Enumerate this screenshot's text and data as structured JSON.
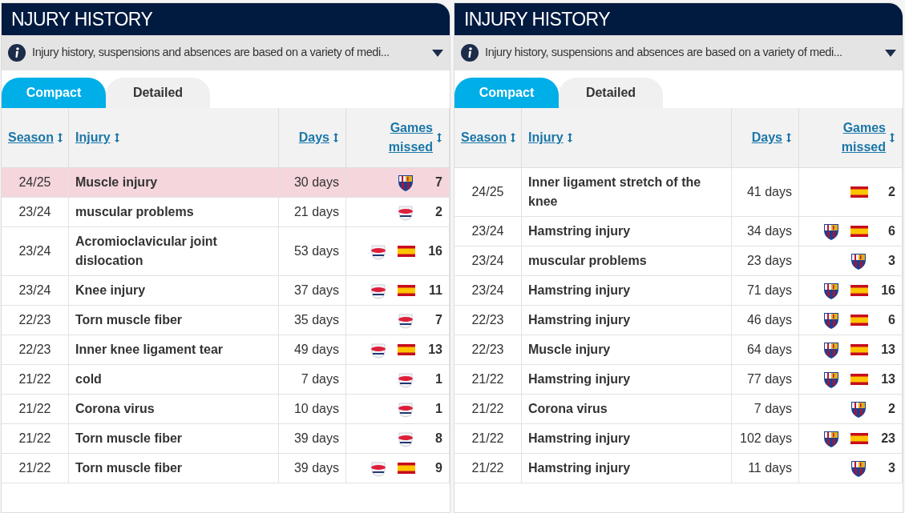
{
  "panels": [
    {
      "title": "NJURY HISTORY",
      "info": "Injury history, suspensions and absences are based on a variety of medi...",
      "tabs": [
        {
          "label": "Compact",
          "selected": true
        },
        {
          "label": "Detailed",
          "selected": false
        }
      ],
      "columns": [
        "Season",
        "Injury",
        "Days",
        "Games missed"
      ],
      "rows": [
        {
          "season": "24/25",
          "injury": "Muscle injury",
          "days": "30 days",
          "games": "7",
          "highlighted": true,
          "marks": [
            {
              "kind": "shield"
            }
          ]
        },
        {
          "season": "23/24",
          "injury": "muscular problems",
          "days": "21 days",
          "games": "2",
          "highlighted": false,
          "marks": [
            {
              "kind": "crest"
            }
          ]
        },
        {
          "season": "23/24",
          "injury": "Acromioclavicular joint dislocation",
          "days": "53 days",
          "games": "16",
          "highlighted": false,
          "marks": [
            {
              "kind": "crest"
            },
            {
              "kind": "flag"
            }
          ]
        },
        {
          "season": "23/24",
          "injury": "Knee injury",
          "days": "37 days",
          "games": "11",
          "highlighted": false,
          "marks": [
            {
              "kind": "crest"
            },
            {
              "kind": "flag"
            }
          ]
        },
        {
          "season": "22/23",
          "injury": "Torn muscle fiber",
          "days": "35 days",
          "games": "7",
          "highlighted": false,
          "marks": [
            {
              "kind": "crest"
            }
          ]
        },
        {
          "season": "22/23",
          "injury": "Inner knee ligament tear",
          "days": "49 days",
          "games": "13",
          "highlighted": false,
          "marks": [
            {
              "kind": "crest"
            },
            {
              "kind": "flag"
            }
          ]
        },
        {
          "season": "21/22",
          "injury": "cold",
          "days": "7 days",
          "games": "1",
          "highlighted": false,
          "marks": [
            {
              "kind": "crest"
            }
          ]
        },
        {
          "season": "21/22",
          "injury": "Corona virus",
          "days": "10 days",
          "games": "1",
          "highlighted": false,
          "marks": [
            {
              "kind": "crest"
            }
          ]
        },
        {
          "season": "21/22",
          "injury": "Torn muscle fiber",
          "days": "39 days",
          "games": "8",
          "highlighted": false,
          "marks": [
            {
              "kind": "crest"
            }
          ]
        },
        {
          "season": "21/22",
          "injury": "Torn muscle fiber",
          "days": "39 days",
          "games": "9",
          "highlighted": false,
          "marks": [
            {
              "kind": "crest"
            },
            {
              "kind": "flag"
            }
          ]
        }
      ]
    },
    {
      "title": "INJURY HISTORY",
      "info": "Injury history, suspensions and absences are based on a variety of medi...",
      "tabs": [
        {
          "label": "Compact",
          "selected": true
        },
        {
          "label": "Detailed",
          "selected": false
        }
      ],
      "columns": [
        "Season",
        "Injury",
        "Days",
        "Games missed"
      ],
      "rows": [
        {
          "season": "24/25",
          "injury": "Inner ligament stretch of the knee",
          "days": "41 days",
          "games": "2",
          "highlighted": false,
          "marks": [
            {
              "kind": "flag"
            }
          ]
        },
        {
          "season": "23/24",
          "injury": "Hamstring injury",
          "days": "34 days",
          "games": "6",
          "highlighted": false,
          "marks": [
            {
              "kind": "shield"
            },
            {
              "kind": "flag"
            }
          ]
        },
        {
          "season": "23/24",
          "injury": "muscular problems",
          "days": "23 days",
          "games": "3",
          "highlighted": false,
          "marks": [
            {
              "kind": "shield"
            }
          ]
        },
        {
          "season": "23/24",
          "injury": "Hamstring injury",
          "days": "71 days",
          "games": "16",
          "highlighted": false,
          "marks": [
            {
              "kind": "shield"
            },
            {
              "kind": "flag"
            }
          ]
        },
        {
          "season": "22/23",
          "injury": "Hamstring injury",
          "days": "46 days",
          "games": "6",
          "highlighted": false,
          "marks": [
            {
              "kind": "shield"
            },
            {
              "kind": "flag"
            }
          ]
        },
        {
          "season": "22/23",
          "injury": "Muscle injury",
          "days": "64 days",
          "games": "13",
          "highlighted": false,
          "marks": [
            {
              "kind": "shield"
            },
            {
              "kind": "flag"
            }
          ]
        },
        {
          "season": "21/22",
          "injury": "Hamstring injury",
          "days": "77 days",
          "games": "13",
          "highlighted": false,
          "marks": [
            {
              "kind": "shield"
            },
            {
              "kind": "flag"
            }
          ]
        },
        {
          "season": "21/22",
          "injury": "Corona virus",
          "days": "7 days",
          "games": "2",
          "highlighted": false,
          "marks": [
            {
              "kind": "shield"
            }
          ]
        },
        {
          "season": "21/22",
          "injury": "Hamstring injury",
          "days": "102 days",
          "games": "23",
          "highlighted": false,
          "marks": [
            {
              "kind": "shield"
            },
            {
              "kind": "flag"
            }
          ]
        },
        {
          "season": "21/22",
          "injury": "Hamstring injury",
          "days": "11 days",
          "games": "3",
          "highlighted": false,
          "marks": [
            {
              "kind": "shield"
            }
          ]
        }
      ]
    }
  ]
}
